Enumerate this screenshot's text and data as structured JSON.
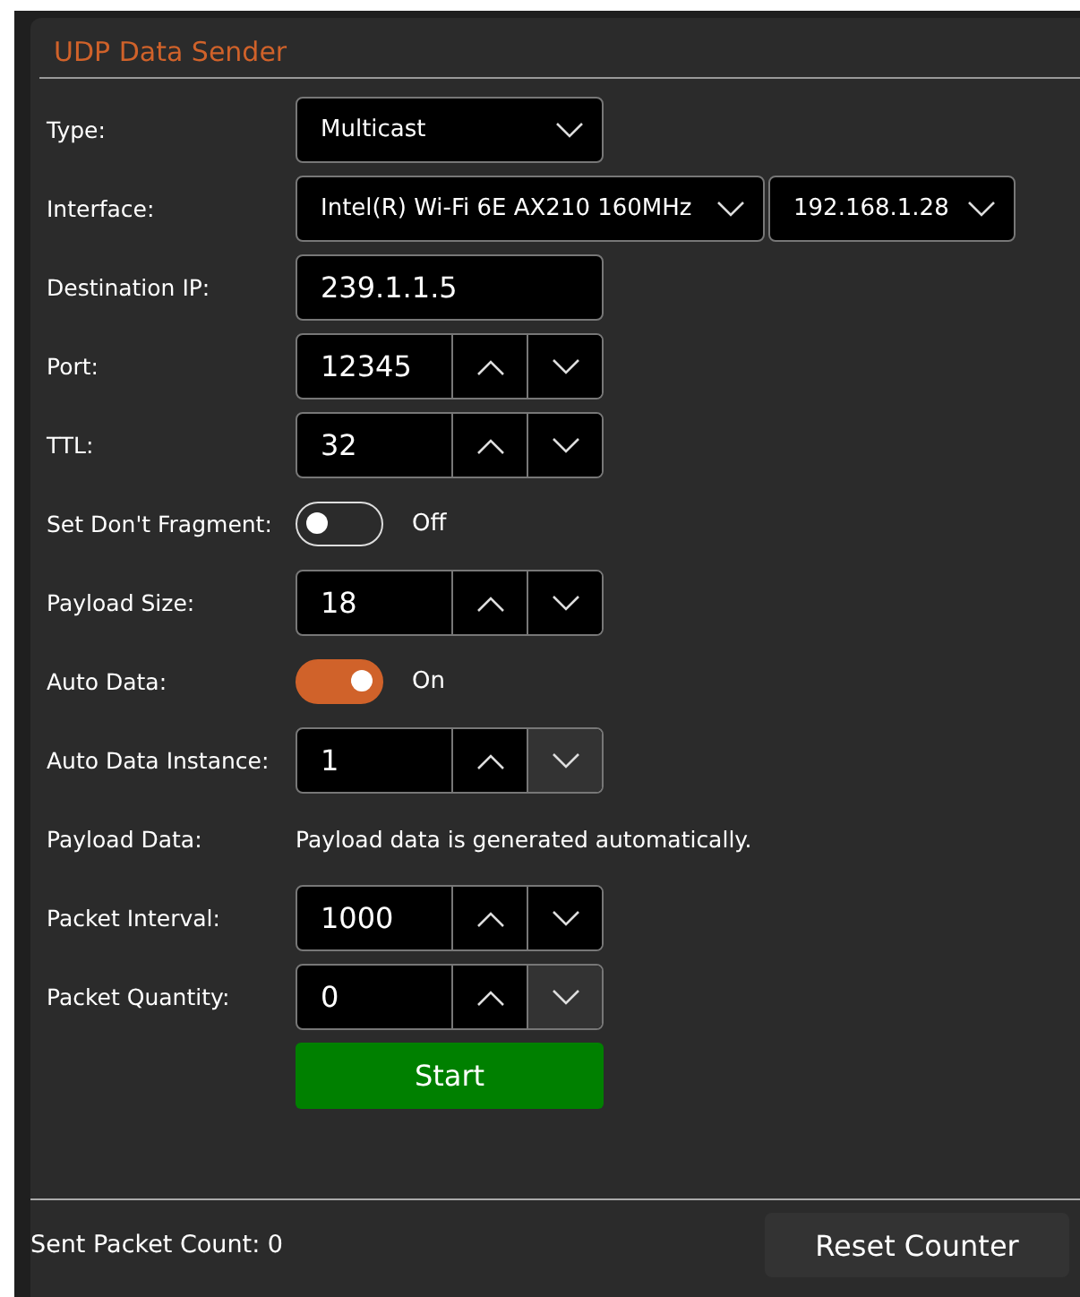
{
  "title": "UDP Data Sender",
  "fields": [
    {
      "kind": "combo",
      "label": "Type:",
      "value": "Multicast"
    },
    {
      "kind": "combo_pair",
      "label": "Interface:",
      "value": "Intel(R) Wi-Fi 6E AX210 160MHz",
      "value_2": "192.168.1.28"
    },
    {
      "kind": "text",
      "label": "Destination IP:",
      "value": "239.1.1.5"
    },
    {
      "kind": "spinner",
      "label": "Port:",
      "value": "12345",
      "down_disabled": false
    },
    {
      "kind": "spinner",
      "label": "TTL:",
      "value": "32",
      "down_disabled": false
    },
    {
      "kind": "toggle",
      "label": "Set Don't Fragment:",
      "on": false,
      "state_text": "Off"
    },
    {
      "kind": "spinner",
      "label": "Payload Size:",
      "value": "18",
      "down_disabled": false
    },
    {
      "kind": "toggle",
      "label": "Auto Data:",
      "on": true,
      "state_text": "On"
    },
    {
      "kind": "spinner",
      "label": "Auto Data Instance:",
      "value": "1",
      "down_disabled": true
    },
    {
      "kind": "note",
      "label": "Payload Data:",
      "text": "Payload data is generated automatically."
    },
    {
      "kind": "spinner",
      "label": "Packet Interval:",
      "value": "1000",
      "down_disabled": false
    },
    {
      "kind": "spinner",
      "label": "Packet Quantity:",
      "value": "0",
      "down_disabled": true
    }
  ],
  "start_button": "Start",
  "footer": {
    "count_text": "Sent Packet Count: 0",
    "reset_button": "Reset Counter"
  }
}
